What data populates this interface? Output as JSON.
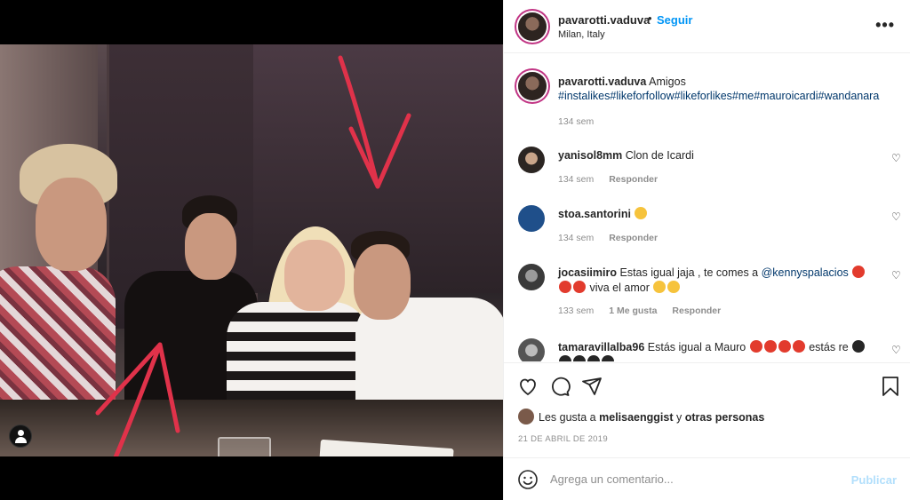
{
  "post": {
    "username": "pavarotti.vaduva",
    "follow_label": "Seguir",
    "separator": "•",
    "location": "Milan, Italy",
    "more_label": "•••"
  },
  "caption": {
    "username": "pavarotti.vaduva",
    "text": "Amigos",
    "hashtags": "#instalikes#likeforfollow#likeforlikes#me#mauroicardi#wandanara",
    "time": "134 sem"
  },
  "comments": [
    {
      "username": "yanisol8mm",
      "text": "Clon de Icardi",
      "time": "134 sem",
      "likes": "",
      "reply": "Responder"
    },
    {
      "username": "stoa.santorini",
      "text": "",
      "time": "134 sem",
      "likes": "",
      "reply": "Responder"
    },
    {
      "username": "jocasiimiro",
      "text": "Estas igual jaja , te comes a",
      "mention": "@kennyspalacios",
      "text2": "viva el amor",
      "time": "133 sem",
      "likes": "1 Me gusta",
      "reply": "Responder"
    },
    {
      "username": "tamaravillalba96",
      "text": "Estás igual a Mauro",
      "text2": "estás re",
      "time": "",
      "likes": "",
      "reply": ""
    }
  ],
  "liked_by": {
    "prefix": "Les gusta a",
    "user": "melisaenggist",
    "connector": "y",
    "others": "otras personas"
  },
  "date": "21 DE ABRIL DE 2019",
  "add_comment": {
    "placeholder": "Agrega un comentario...",
    "publish": "Publicar"
  },
  "colors": {
    "accent": "#0095f6",
    "publish_disabled": "#b2dffc",
    "hashtag": "#00376b",
    "muted": "#8e8e8e"
  },
  "icons": [
    "heart-icon",
    "comment-icon",
    "share-icon",
    "bookmark-icon",
    "smile-icon",
    "more-icon",
    "user-tag-icon"
  ]
}
